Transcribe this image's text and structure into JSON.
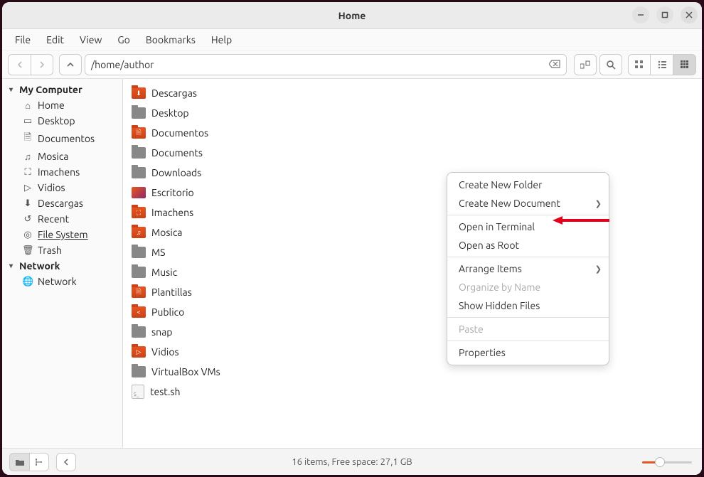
{
  "title": "Home",
  "menu": [
    "File",
    "Edit",
    "View",
    "Go",
    "Bookmarks",
    "Help"
  ],
  "path": "/home/author",
  "sidebar": {
    "groups": [
      {
        "label": "My Computer",
        "items": [
          {
            "icon": "⌂",
            "label": "Home"
          },
          {
            "icon": "▭",
            "label": "Desktop"
          },
          {
            "icon": "🗎",
            "label": "Documentos"
          },
          {
            "icon": "♫",
            "label": "Mosica"
          },
          {
            "icon": "⛶",
            "label": "Imachens"
          },
          {
            "icon": "▷",
            "label": "Vidios"
          },
          {
            "icon": "⬇",
            "label": "Descargas"
          },
          {
            "icon": "↺",
            "label": "Recent"
          },
          {
            "icon": "◎",
            "label": "File System",
            "underline": true
          },
          {
            "icon": "🗑",
            "label": "Trash"
          }
        ]
      },
      {
        "label": "Network",
        "items": [
          {
            "icon": "🌐",
            "label": "Network"
          }
        ]
      }
    ]
  },
  "files": [
    {
      "name": "Descargas",
      "type": "folder",
      "style": "orange",
      "glyph": "⬇"
    },
    {
      "name": "Desktop",
      "type": "folder",
      "style": "grey"
    },
    {
      "name": "Documentos",
      "type": "folder",
      "style": "orange",
      "glyph": "🗎"
    },
    {
      "name": "Documents",
      "type": "folder",
      "style": "grey"
    },
    {
      "name": "Downloads",
      "type": "folder",
      "style": "grey"
    },
    {
      "name": "Escritorio",
      "type": "escritorio"
    },
    {
      "name": "Imachens",
      "type": "folder",
      "style": "orange",
      "glyph": "⛶"
    },
    {
      "name": "Mosica",
      "type": "folder",
      "style": "orange",
      "glyph": "♫"
    },
    {
      "name": "MS",
      "type": "folder",
      "style": "grey"
    },
    {
      "name": "Music",
      "type": "folder",
      "style": "grey"
    },
    {
      "name": "Plantillas",
      "type": "folder",
      "style": "orange",
      "glyph": "🗎"
    },
    {
      "name": "Publico",
      "type": "folder",
      "style": "orange",
      "glyph": "<"
    },
    {
      "name": "snap",
      "type": "folder",
      "style": "grey"
    },
    {
      "name": "Vidios",
      "type": "folder",
      "style": "orange",
      "glyph": "▷"
    },
    {
      "name": "VirtualBox VMs",
      "type": "folder",
      "style": "grey"
    },
    {
      "name": "test.sh",
      "type": "file"
    }
  ],
  "context": [
    {
      "label": "Create New Folder"
    },
    {
      "label": "Create New Document",
      "sub": true
    },
    {
      "sep": true
    },
    {
      "label": "Open in Terminal"
    },
    {
      "label": "Open as Root"
    },
    {
      "sep": true
    },
    {
      "label": "Arrange Items",
      "sub": true
    },
    {
      "label": "Organize by Name",
      "disabled": true
    },
    {
      "label": "Show Hidden Files"
    },
    {
      "sep": true
    },
    {
      "label": "Paste",
      "disabled": true
    },
    {
      "sep": true
    },
    {
      "label": "Properties"
    }
  ],
  "status": "16 items, Free space: 27,1 GB"
}
